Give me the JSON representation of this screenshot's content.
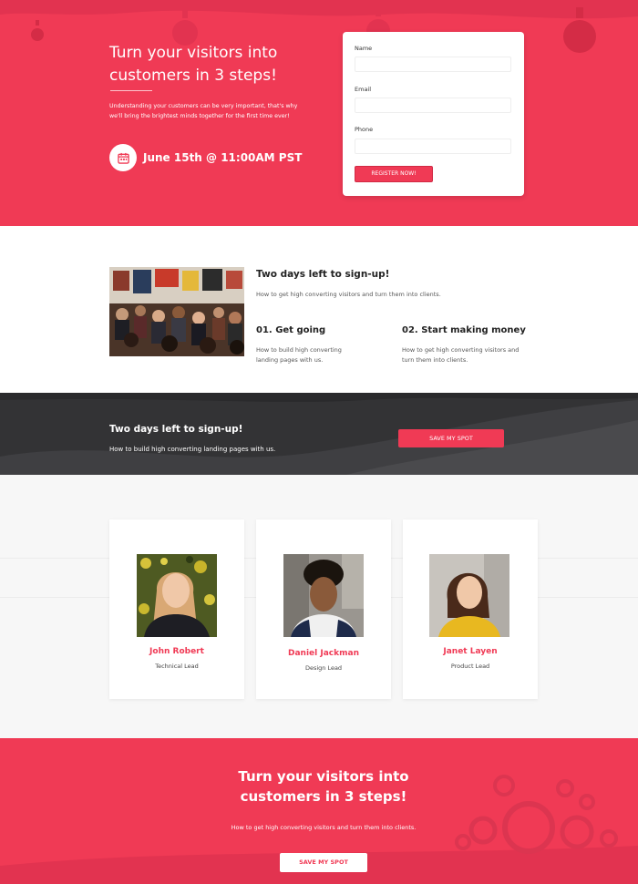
{
  "hero": {
    "title_line1": "Turn your visitors into",
    "title_line2": "customers in 3 steps!",
    "desc_line1": "Understanding your customers can be very important, that's why",
    "desc_line2": "we'll bring the brightest minds together for the first time ever!",
    "date": "June 15th @ 11:00AM PST",
    "date_icon": "calendar-icon"
  },
  "form": {
    "name_label": "Name",
    "name_value": "",
    "email_label": "Email",
    "email_value": "",
    "phone_label": "Phone",
    "phone_value": "",
    "button": "REGISTER NOW!"
  },
  "info": {
    "title": "Two days left to sign-up!",
    "subtitle": "How to get high converting visitors and turn them into clients.",
    "steps": [
      {
        "title": "01. Get going",
        "desc_line1": "How to build high converting",
        "desc_line2": "landing pages with us."
      },
      {
        "title": "02. Start making money",
        "desc_line1": "How to get high converting visitors and",
        "desc_line2": "turn them into clients."
      }
    ]
  },
  "cta": {
    "title": "Two days left to sign-up!",
    "subtitle": "How to build high converting landing pages with us.",
    "button": "SAVE MY SPOT"
  },
  "team": [
    {
      "name": "John Robert",
      "role": "Technical Lead"
    },
    {
      "name": "Daniel Jackman",
      "role": "Design Lead"
    },
    {
      "name": "Janet Layen",
      "role": "Product Lead"
    }
  ],
  "bottom": {
    "title_line1": "Turn your visitors into",
    "title_line2": "customers in 3 steps!",
    "subtitle": "How to get high converting visitors and turn them into clients.",
    "button": "SAVE MY SPOT"
  },
  "colors": {
    "brand": "#f03a55",
    "dark": "#333335",
    "light_bg": "#f7f7f7"
  }
}
